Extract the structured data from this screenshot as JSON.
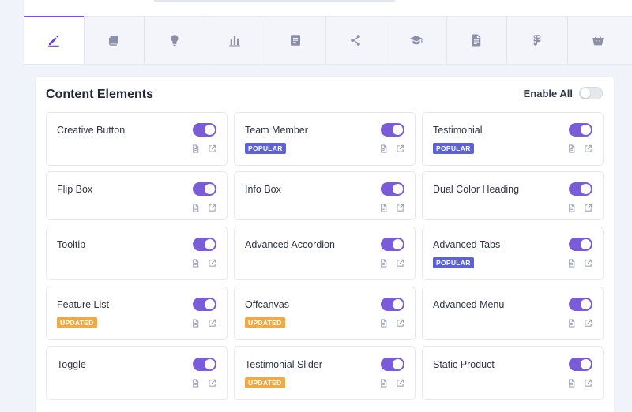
{
  "tabs": [
    {
      "icon": "pencil-icon",
      "active": true
    },
    {
      "icon": "layers-icon",
      "active": false
    },
    {
      "icon": "lightbulb-icon",
      "active": false
    },
    {
      "icon": "bar-chart-icon",
      "active": false
    },
    {
      "icon": "document-icon",
      "active": false
    },
    {
      "icon": "share-icon",
      "active": false
    },
    {
      "icon": "graduation-cap-icon",
      "active": false
    },
    {
      "icon": "file-text-icon",
      "active": false
    },
    {
      "icon": "figma-icon",
      "active": false
    },
    {
      "icon": "basket-icon",
      "active": false
    }
  ],
  "panel": {
    "title": "Content Elements",
    "enable_all_label": "Enable All",
    "enable_all_on": false
  },
  "elements": [
    {
      "name": "Creative Button",
      "enabled": true,
      "badge": ""
    },
    {
      "name": "Team Member",
      "enabled": true,
      "badge": "POPULAR"
    },
    {
      "name": "Testimonial",
      "enabled": true,
      "badge": "POPULAR"
    },
    {
      "name": "Flip Box",
      "enabled": true,
      "badge": ""
    },
    {
      "name": "Info Box",
      "enabled": true,
      "badge": ""
    },
    {
      "name": "Dual Color Heading",
      "enabled": true,
      "badge": ""
    },
    {
      "name": "Tooltip",
      "enabled": true,
      "badge": ""
    },
    {
      "name": "Advanced Accordion",
      "enabled": true,
      "badge": ""
    },
    {
      "name": "Advanced Tabs",
      "enabled": true,
      "badge": "POPULAR"
    },
    {
      "name": "Feature List",
      "enabled": true,
      "badge": "UPDATED"
    },
    {
      "name": "Offcanvas",
      "enabled": true,
      "badge": "UPDATED"
    },
    {
      "name": "Advanced Menu",
      "enabled": true,
      "badge": ""
    },
    {
      "name": "Toggle",
      "enabled": true,
      "badge": ""
    },
    {
      "name": "Testimonial Slider",
      "enabled": true,
      "badge": "UPDATED"
    },
    {
      "name": "Static Product",
      "enabled": true,
      "badge": ""
    }
  ],
  "colors": {
    "accent": "#7a5bd8",
    "popular_badge": "#5b61d9",
    "updated_badge": "#f0a94a"
  }
}
